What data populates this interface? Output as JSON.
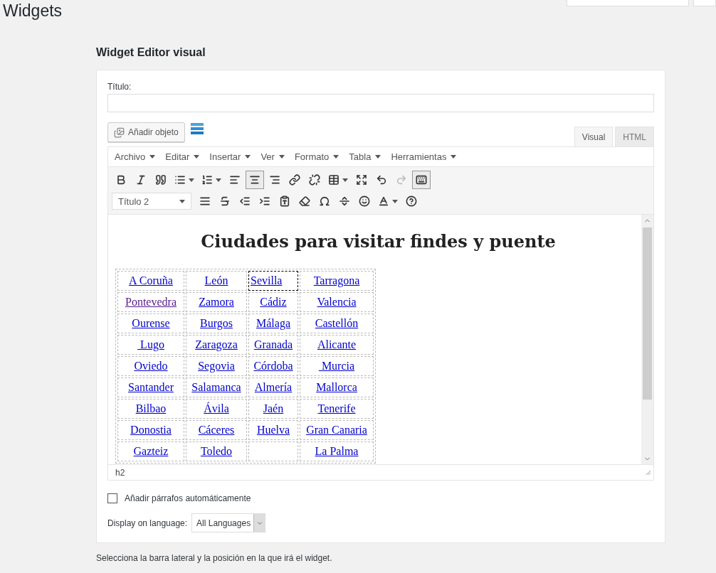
{
  "page_title": "Widgets",
  "widget": {
    "title": "Widget Editor visual",
    "title_field": {
      "label": "Título:"
    },
    "add_media": {
      "label": "Añadir objeto"
    },
    "editor_tabs": [
      {
        "label": "Visual",
        "selected": true
      },
      {
        "label": "HTML",
        "selected": false
      }
    ],
    "menus": [
      {
        "label": "Archivo"
      },
      {
        "label": "Editar"
      },
      {
        "label": "Insertar"
      },
      {
        "label": "Ver"
      },
      {
        "label": "Formato"
      },
      {
        "label": "Tabla"
      },
      {
        "label": "Herramientas"
      }
    ],
    "toolbar_row_1": [
      {
        "kind": "bold",
        "active": false,
        "disabled": false,
        "dropdown": false
      },
      {
        "kind": "italic",
        "active": false,
        "disabled": false,
        "dropdown": false
      },
      {
        "kind": "quote",
        "active": false,
        "disabled": false,
        "dropdown": false
      },
      {
        "kind": "bullets",
        "active": false,
        "disabled": false,
        "dropdown": true
      },
      {
        "kind": "numbers",
        "active": false,
        "disabled": false,
        "dropdown": true
      },
      {
        "kind": "align-left",
        "active": false,
        "disabled": false,
        "dropdown": false
      },
      {
        "kind": "align-center",
        "active": true,
        "disabled": false,
        "dropdown": false
      },
      {
        "kind": "align-right",
        "active": false,
        "disabled": false,
        "dropdown": false
      },
      {
        "kind": "link",
        "active": false,
        "disabled": false,
        "dropdown": false
      },
      {
        "kind": "unlink",
        "active": false,
        "disabled": false,
        "dropdown": false
      },
      {
        "kind": "table",
        "active": false,
        "disabled": false,
        "dropdown": true
      },
      {
        "kind": "fullscreen",
        "active": false,
        "disabled": false,
        "dropdown": false
      },
      {
        "kind": "undo",
        "active": false,
        "disabled": false,
        "dropdown": false
      },
      {
        "kind": "redo",
        "active": false,
        "disabled": true,
        "dropdown": false
      },
      {
        "kind": "keyboard",
        "active": true,
        "disabled": false,
        "dropdown": false
      }
    ],
    "format_select": {
      "value": "Título 2"
    },
    "toolbar_row_2": [
      {
        "kind": "justify",
        "active": false,
        "disabled": false,
        "dropdown": false
      },
      {
        "kind": "strikethrough",
        "active": false,
        "disabled": false,
        "dropdown": false
      },
      {
        "kind": "outdent",
        "active": false,
        "disabled": false,
        "dropdown": false
      },
      {
        "kind": "indent",
        "active": false,
        "disabled": false,
        "dropdown": false
      },
      {
        "kind": "paste-text",
        "active": false,
        "disabled": false,
        "dropdown": false
      },
      {
        "kind": "eraser",
        "active": false,
        "disabled": false,
        "dropdown": false
      },
      {
        "kind": "omega",
        "active": false,
        "disabled": false,
        "dropdown": false
      },
      {
        "kind": "more",
        "active": false,
        "disabled": false,
        "dropdown": false
      },
      {
        "kind": "emoji",
        "active": false,
        "disabled": false,
        "dropdown": false
      },
      {
        "kind": "text-color",
        "active": false,
        "disabled": false,
        "dropdown": true
      },
      {
        "kind": "help",
        "active": false,
        "disabled": false,
        "dropdown": false
      }
    ],
    "content": {
      "heading": "Ciudades para visitar findes y puente",
      "table": [
        [
          {
            "text": "A Coruña",
            "visited": false,
            "selected": false
          },
          {
            "text": "León",
            "visited": false,
            "selected": false
          },
          {
            "text": "Sevilla",
            "visited": false,
            "selected": true
          },
          {
            "text": "Tarragona",
            "visited": false,
            "selected": false
          }
        ],
        [
          {
            "text": "Pontevedra",
            "visited": true,
            "selected": false
          },
          {
            "text": "Zamora",
            "visited": false,
            "selected": false
          },
          {
            "text": "Cádiz",
            "visited": false,
            "selected": false
          },
          {
            "text": "Valencia",
            "visited": false,
            "selected": false
          }
        ],
        [
          {
            "text": "Ourense",
            "visited": false,
            "selected": false
          },
          {
            "text": "Burgos",
            "visited": false,
            "selected": false
          },
          {
            "text": "Málaga",
            "visited": false,
            "selected": false
          },
          {
            "text": "Castellón",
            "visited": false,
            "selected": false
          }
        ],
        [
          {
            "text": " Lugo",
            "visited": false,
            "selected": false
          },
          {
            "text": "Zaragoza",
            "visited": false,
            "selected": false
          },
          {
            "text": "Granada",
            "visited": false,
            "selected": false
          },
          {
            "text": "Alicante",
            "visited": false,
            "selected": false
          }
        ],
        [
          {
            "text": "Oviedo",
            "visited": false,
            "selected": false
          },
          {
            "text": "Segovia",
            "visited": false,
            "selected": false
          },
          {
            "text": "Córdoba",
            "visited": false,
            "selected": false
          },
          {
            "text": " Murcia",
            "visited": false,
            "selected": false
          }
        ],
        [
          {
            "text": "Santander",
            "visited": false,
            "selected": false
          },
          {
            "text": "Salamanca",
            "visited": false,
            "selected": false
          },
          {
            "text": "Almería",
            "visited": false,
            "selected": false
          },
          {
            "text": "Mallorca",
            "visited": false,
            "selected": false
          }
        ],
        [
          {
            "text": "Bilbao",
            "visited": false,
            "selected": false
          },
          {
            "text": "Ávila",
            "visited": false,
            "selected": false
          },
          {
            "text": "Jaén",
            "visited": false,
            "selected": false
          },
          {
            "text": "Tenerife",
            "visited": false,
            "selected": false
          }
        ],
        [
          {
            "text": "Donostia",
            "visited": false,
            "selected": false
          },
          {
            "text": "Cáceres",
            "visited": false,
            "selected": false
          },
          {
            "text": "Huelva",
            "visited": false,
            "selected": false
          },
          {
            "text": "Gran Canaria",
            "visited": false,
            "selected": false
          }
        ],
        [
          {
            "text": "Gazteiz",
            "visited": false,
            "selected": false
          },
          {
            "text": "Toledo",
            "visited": false,
            "selected": false
          },
          {
            "selected": false
          },
          {
            "text": "La Palma",
            "visited": false,
            "selected": false
          }
        ]
      ]
    },
    "status_path": "h2",
    "auto_paragraphs": {
      "label": "Añadir párrafos automáticamente",
      "checked": false
    },
    "language": {
      "label": "Display on language:",
      "value": "All Languages"
    }
  },
  "footer_note": "Selecciona la barra lateral y la posición en la que irá el widget."
}
